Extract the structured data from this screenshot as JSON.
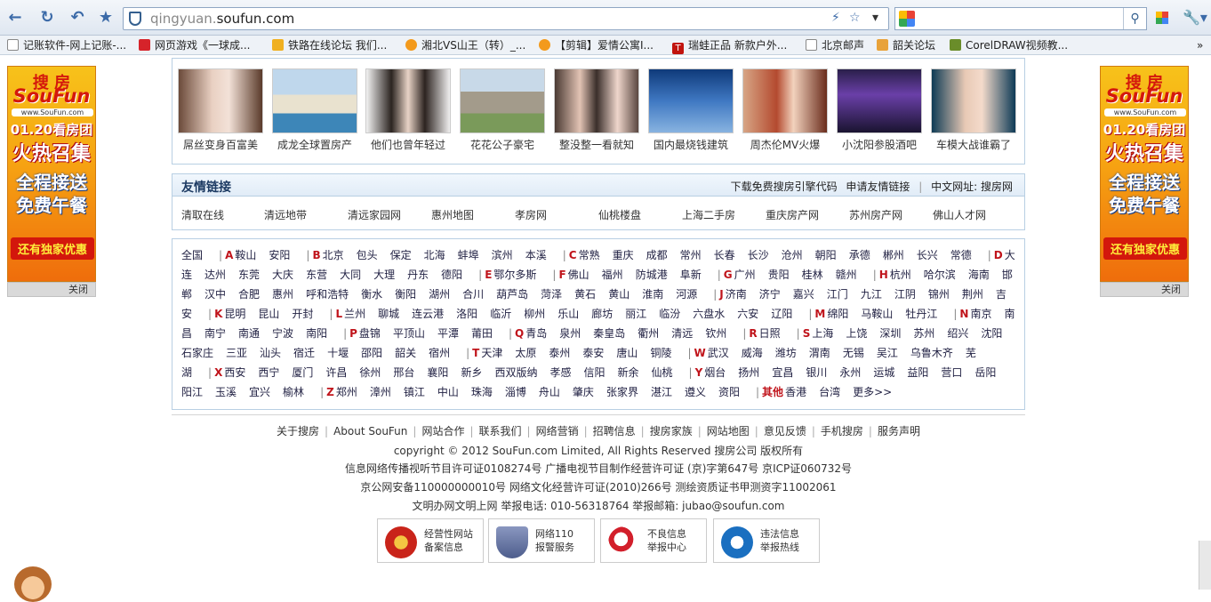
{
  "browser": {
    "url_host_prefix": "qingyuan.",
    "url_host_main": "soufun.com",
    "bookmarks": [
      "记账软件-网上记账-...",
      "网页游戏《一球成...",
      "铁路在线论坛 我们...",
      "湘北VS山王（转）_...",
      "【剪辑】爱情公寓I...",
      "瑞蛙正品 新款户外...",
      "北京邮声",
      "韶关论坛",
      "CorelDRAW视频教..."
    ]
  },
  "side_ad": {
    "logo_top": "搜 房",
    "logo_main": "SouFun",
    "site": "www.SouFun.com",
    "line1": "01.20看房团",
    "line2": "火热召集",
    "line3": "全程接送",
    "line4": "免费午餐",
    "line5": "还有独家优惠",
    "close": "关闭"
  },
  "photos": [
    "屌丝变身百富美",
    "成龙全球置房产",
    "他们也曾年轻过",
    "花花公子豪宅",
    "整没整一看就知",
    "国内最烧钱建筑",
    "周杰伦MV火爆",
    "小沈阳参股酒吧",
    "车模大战谁霸了"
  ],
  "friends": {
    "title": "友情链接",
    "actions": [
      "下载免费搜房引擎代码",
      "申请友情链接",
      "中文网址: 搜房网"
    ],
    "links": [
      "清取在线",
      "清远地带",
      "清远家园网",
      "惠州地图",
      "孝房网",
      "仙桃楼盘",
      "上海二手房",
      "重庆房产网",
      "苏州房产网",
      "佛山人才网"
    ]
  },
  "cities": [
    {
      "letter": "",
      "items": [
        "全国"
      ]
    },
    {
      "letter": "A",
      "items": [
        "鞍山",
        "安阳"
      ]
    },
    {
      "letter": "B",
      "items": [
        "北京",
        "包头",
        "保定",
        "北海",
        "蚌埠",
        "滨州",
        "本溪"
      ]
    },
    {
      "letter": "C",
      "items": [
        "常熟",
        "重庆",
        "成都",
        "常州",
        "长春",
        "长沙",
        "沧州",
        "朝阳",
        "承德",
        "郴州",
        "长兴",
        "常德"
      ]
    },
    {
      "letter": "D",
      "items": [
        "大连",
        "达州",
        "东莞",
        "大庆",
        "东营",
        "大同",
        "大理",
        "丹东",
        "德阳"
      ]
    },
    {
      "letter": "E",
      "items": [
        "鄂尔多斯"
      ]
    },
    {
      "letter": "F",
      "items": [
        "佛山",
        "福州",
        "防城港",
        "阜新"
      ]
    },
    {
      "letter": "G",
      "items": [
        "广州",
        "贵阳",
        "桂林",
        "赣州"
      ]
    },
    {
      "letter": "H",
      "items": [
        "杭州",
        "哈尔滨",
        "海南",
        "邯郸",
        "汉中",
        "合肥",
        "惠州",
        "呼和浩特",
        "衡水",
        "衡阳",
        "湖州",
        "合川",
        "葫芦岛",
        "菏泽",
        "黄石",
        "黄山",
        "淮南",
        "河源"
      ]
    },
    {
      "letter": "J",
      "items": [
        "济南",
        "济宁",
        "嘉兴",
        "江门",
        "九江",
        "江阴",
        "锦州",
        "荆州",
        "吉安"
      ]
    },
    {
      "letter": "K",
      "items": [
        "昆明",
        "昆山",
        "开封"
      ]
    },
    {
      "letter": "L",
      "items": [
        "兰州",
        "聊城",
        "连云港",
        "洛阳",
        "临沂",
        "柳州",
        "乐山",
        "廊坊",
        "丽江",
        "临汾",
        "六盘水",
        "六安",
        "辽阳"
      ]
    },
    {
      "letter": "M",
      "items": [
        "绵阳",
        "马鞍山",
        "牡丹江"
      ]
    },
    {
      "letter": "N",
      "items": [
        "南京",
        "南昌",
        "南宁",
        "南通",
        "宁波",
        "南阳"
      ]
    },
    {
      "letter": "P",
      "items": [
        "盘锦",
        "平顶山",
        "平潭",
        "莆田"
      ]
    },
    {
      "letter": "Q",
      "items": [
        "青岛",
        "泉州",
        "秦皇岛",
        "衢州",
        "清远",
        "钦州"
      ]
    },
    {
      "letter": "R",
      "items": [
        "日照"
      ]
    },
    {
      "letter": "S",
      "items": [
        "上海",
        "上饶",
        "深圳",
        "苏州",
        "绍兴",
        "沈阳",
        "石家庄",
        "三亚",
        "汕头",
        "宿迁",
        "十堰",
        "邵阳",
        "韶关",
        "宿州"
      ]
    },
    {
      "letter": "T",
      "items": [
        "天津",
        "太原",
        "泰州",
        "泰安",
        "唐山",
        "铜陵"
      ]
    },
    {
      "letter": "W",
      "items": [
        "武汉",
        "威海",
        "潍坊",
        "渭南",
        "无锡",
        "吴江",
        "乌鲁木齐",
        "芜湖"
      ]
    },
    {
      "letter": "X",
      "items": [
        "西安",
        "西宁",
        "厦门",
        "许昌",
        "徐州",
        "邢台",
        "襄阳",
        "新乡",
        "西双版纳",
        "孝感",
        "信阳",
        "新余",
        "仙桃"
      ]
    },
    {
      "letter": "Y",
      "items": [
        "烟台",
        "扬州",
        "宜昌",
        "银川",
        "永州",
        "运城",
        "益阳",
        "营口",
        "岳阳",
        "阳江",
        "玉溪",
        "宜兴",
        "榆林"
      ]
    },
    {
      "letter": "Z",
      "items": [
        "郑州",
        "漳州",
        "镇江",
        "中山",
        "珠海",
        "淄博",
        "舟山",
        "肇庆",
        "张家界",
        "湛江",
        "遵义",
        "资阳"
      ]
    },
    {
      "letter": "其他",
      "items": [
        "香港",
        "台湾",
        "更多>>"
      ]
    }
  ],
  "footer": {
    "nav": [
      "关于搜房",
      "About SouFun",
      "网站合作",
      "联系我们",
      "网络营销",
      "招聘信息",
      "搜房家族",
      "网站地图",
      "意见反馈",
      "手机搜房",
      "服务声明"
    ],
    "copyright": "copyright © 2012 SouFun.com Limited, All Rights Reserved 搜房公司 版权所有",
    "license1": "信息网络传播视听节目许可证0108274号 广播电视节目制作经营许可证 (京)字第647号 京ICP证060732号",
    "license2": "京公网安备110000000010号 网络文化经营许可证(2010)266号 测绘资质证书甲测资字11002061",
    "contact": "文明办网文明上网 举报电话: 010-56318764 举报邮箱: jubao@soufun.com",
    "badges": [
      {
        "l1": "经营性网站",
        "l2": "备案信息",
        "color": "#c9241a"
      },
      {
        "l1": "网络110",
        "l2": "报警服务",
        "color": "#6b7aa8"
      },
      {
        "l1": "不良信息",
        "l2": "举报中心",
        "color": "#d21f2b"
      },
      {
        "l1": "违法信息",
        "l2": "举报热线",
        "color": "#1a6fc0"
      }
    ]
  }
}
